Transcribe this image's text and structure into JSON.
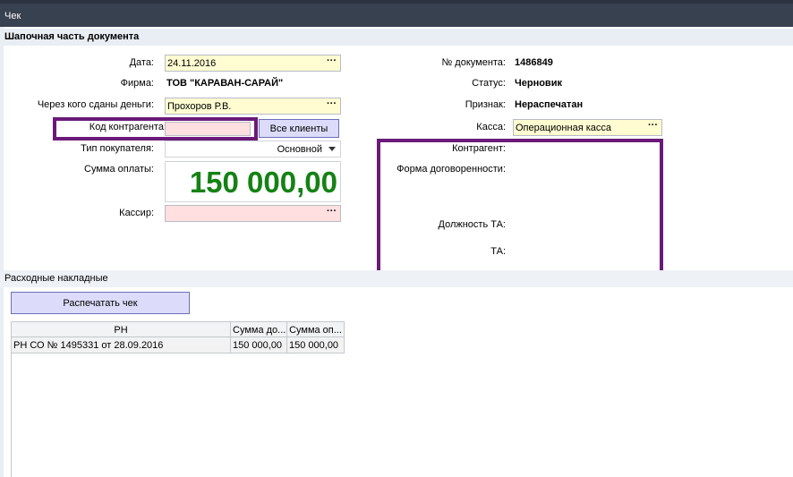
{
  "window": {
    "title": "Чек"
  },
  "header_section": {
    "title": "Шапочная часть документа"
  },
  "left_form": {
    "date": {
      "label": "Дата:",
      "value": "24.11.2016"
    },
    "firm": {
      "label": "Фирма:",
      "value": "ТОВ \"КАРАВАН-САРАЙ\""
    },
    "money_via": {
      "label": "Через кого сданы деньги:",
      "value": "Прохоров Р.В."
    },
    "contractor_code": {
      "label": "Код контрагента:",
      "value": ""
    },
    "all_clients_button": "Все клиенты",
    "buyer_type": {
      "label": "Тип покупателя:",
      "value": "Основной"
    },
    "payment_sum": {
      "label": "Сумма оплаты:",
      "value": "150 000,00"
    },
    "cashier": {
      "label": "Кассир:",
      "value": ""
    }
  },
  "right_form": {
    "doc_number": {
      "label": "№ документа:",
      "value": "1486849"
    },
    "status": {
      "label": "Статус:",
      "value": "Черновик"
    },
    "sign": {
      "label": "Признак:",
      "value": "Нераспечатан"
    },
    "cash_desk": {
      "label": "Касса:",
      "value": "Операционная касса"
    },
    "contractor": {
      "label": "Контрагент:"
    },
    "agreement_form": {
      "label": "Форма договоренности:"
    },
    "ta_position": {
      "label": "Должность ТА:"
    },
    "ta": {
      "label": "ТА:"
    }
  },
  "dots": "···",
  "invoices_section": {
    "title": "Расходные накладные"
  },
  "print_button": "Распечатать чек",
  "table": {
    "columns": [
      "РН",
      "Сумма до...",
      "Сумма оп..."
    ],
    "rows": [
      [
        "РН СО № 1495331 от 28.09.2016",
        "150 000,00",
        "150 000,00"
      ]
    ]
  },
  "colors": {
    "titlebar": "#37414f",
    "highlight": "#6a1a78",
    "amount": "#148214",
    "required_field": "#ffdfe0",
    "lookup_field": "#fffcd2"
  }
}
